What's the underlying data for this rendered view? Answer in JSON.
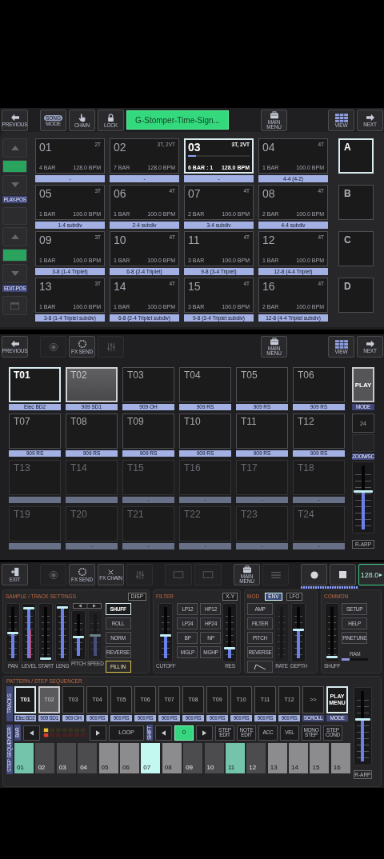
{
  "pattern_panel": {
    "toolbar": [
      [
        {
          "kind": "arrow-left",
          "label": "PREVIOUS",
          "disabled": false
        }
      ],
      [
        {
          "kind": "song",
          "badge": "SONG",
          "label": "MODE",
          "disabled": false
        },
        {
          "kind": "hand",
          "label": "CHAIN",
          "disabled": false
        },
        {
          "kind": "lock",
          "label": "LOCK",
          "disabled": false
        },
        {
          "kind": "title",
          "text": "G-Stomper-Time-Sign..."
        }
      ],
      [
        {
          "kind": "menu-box",
          "label": "MAIN MENU",
          "disabled": false
        }
      ],
      [
        {
          "kind": "grid",
          "label": "VIEW",
          "disabled": false
        },
        {
          "kind": "arrow-right",
          "label": "NEXT",
          "disabled": false
        }
      ]
    ],
    "play_pos_label": "PLAY-POS",
    "edit_pos_label": "EDIT-POS",
    "patterns": [
      {
        "number": "01",
        "tracks": "2T",
        "length": "4 BAR",
        "tempo": "128.0 BPM",
        "label": "-",
        "selected": false
      },
      {
        "number": "02",
        "tracks": "3T, 2VT",
        "length": "7 BAR",
        "tempo": "128.0 BPM",
        "label": "-",
        "selected": false
      },
      {
        "number": "03",
        "tracks": "3T, 2VT",
        "length": "6 BAR : 1",
        "tempo": "128.0 BPM",
        "label": "-",
        "selected": true,
        "progress": {
          "level": 0.13
        }
      },
      {
        "number": "04",
        "tracks": "4T",
        "length": "1 BAR",
        "tempo": "100.0 BPM",
        "label": "4-4 (4-2)",
        "selected": false
      },
      {
        "number": "05",
        "tracks": "3T",
        "length": "1 BAR",
        "tempo": "100.0 BPM",
        "label": "1-4 subdiv",
        "selected": false
      },
      {
        "number": "06",
        "tracks": "4T",
        "length": "1 BAR",
        "tempo": "100.0 BPM",
        "label": "2-4 subdiv",
        "selected": false
      },
      {
        "number": "07",
        "tracks": "4T",
        "length": "2 BAR",
        "tempo": "100.0 BPM",
        "label": "3-4 subdiv",
        "selected": false
      },
      {
        "number": "08",
        "tracks": "4T",
        "length": "2 BAR",
        "tempo": "100.0 BPM",
        "label": "4-4 subdiv",
        "selected": false
      },
      {
        "number": "09",
        "tracks": "3T",
        "length": "1 BAR",
        "tempo": "100.0 BPM",
        "label": "3-8 (1-4 Triplet)",
        "selected": false
      },
      {
        "number": "10",
        "tracks": "4T",
        "length": "1 BAR",
        "tempo": "100.0 BPM",
        "label": "6-8 (2-4 Triplet)",
        "selected": false
      },
      {
        "number": "11",
        "tracks": "4T",
        "length": "3 BAR",
        "tempo": "100.0 BPM",
        "label": "9-8 (3-4 Triplet)",
        "selected": false
      },
      {
        "number": "12",
        "tracks": "4T",
        "length": "1 BAR",
        "tempo": "100.0 BPM",
        "label": "12-8 (4-4 Triplet)",
        "selected": false
      },
      {
        "number": "13",
        "tracks": "3T",
        "length": "1 BAR",
        "tempo": "100.0 BPM",
        "label": "3-8 (1-4 Triplet subdiv)",
        "selected": false
      },
      {
        "number": "14",
        "tracks": "4T",
        "length": "1 BAR",
        "tempo": "100.0 BPM",
        "label": "6-8 (2-4 Triplet subdiv)",
        "selected": false
      },
      {
        "number": "15",
        "tracks": "4T",
        "length": "3 BAR",
        "tempo": "100.0 BPM",
        "label": "9-8 (3-4 Triplet subdiv)",
        "selected": false
      },
      {
        "number": "16",
        "tracks": "4T",
        "length": "2 BAR",
        "tempo": "100.0 BPM",
        "label": "12-8 (4-4 Triplet subdiv)",
        "selected": false
      }
    ],
    "banks": [
      {
        "name": "A",
        "selected": true
      },
      {
        "name": "B",
        "selected": false
      },
      {
        "name": "C",
        "selected": false
      },
      {
        "name": "D",
        "selected": false
      }
    ]
  },
  "track_panel": {
    "toolbar": [
      [
        {
          "kind": "arrow-left",
          "label": "PREVIOUS",
          "disabled": false
        }
      ],
      [
        {
          "kind": "dim-circle",
          "disabled": true
        },
        {
          "kind": "fx-send",
          "label": "FX SEND",
          "disabled": false
        },
        {
          "kind": "mixer",
          "disabled": true
        }
      ],
      [
        {
          "kind": "menu-box",
          "label": "MAIN MENU",
          "disabled": false
        }
      ],
      [
        {
          "kind": "grid",
          "label": "VIEW",
          "disabled": false
        },
        {
          "kind": "arrow-right",
          "label": "NEXT",
          "disabled": false
        }
      ]
    ],
    "tracks": [
      {
        "name": "T01",
        "sample": "Elec BD2",
        "selected": true,
        "highlighted": false,
        "disabled": false
      },
      {
        "name": "T02",
        "sample": "909 SD1",
        "selected": false,
        "highlighted": true,
        "disabled": false
      },
      {
        "name": "T03",
        "sample": "909 OH",
        "selected": false,
        "highlighted": false,
        "disabled": false
      },
      {
        "name": "T04",
        "sample": "909 RS",
        "selected": false,
        "highlighted": false,
        "disabled": false
      },
      {
        "name": "T05",
        "sample": "909 RS",
        "selected": false,
        "highlighted": false,
        "disabled": false
      },
      {
        "name": "T06",
        "sample": "909 RS",
        "selected": false,
        "highlighted": false,
        "disabled": false
      },
      {
        "name": "T07",
        "sample": "909 RS",
        "selected": false,
        "highlighted": false,
        "disabled": false
      },
      {
        "name": "T08",
        "sample": "909 RS",
        "selected": false,
        "highlighted": false,
        "disabled": false
      },
      {
        "name": "T09",
        "sample": "909 RS",
        "selected": false,
        "highlighted": false,
        "disabled": false
      },
      {
        "name": "T10",
        "sample": "909 RS",
        "selected": false,
        "highlighted": false,
        "disabled": false
      },
      {
        "name": "T11",
        "sample": "909 RS",
        "selected": false,
        "highlighted": false,
        "disabled": false
      },
      {
        "name": "T12",
        "sample": "909 RS",
        "selected": false,
        "highlighted": false,
        "disabled": false
      },
      {
        "name": "T13",
        "selected": false,
        "highlighted": false,
        "disabled": true
      },
      {
        "name": "T14",
        "selected": false,
        "highlighted": false,
        "disabled": true
      },
      {
        "name": "T15",
        "sample": "-",
        "selected": false,
        "highlighted": false,
        "disabled": true
      },
      {
        "name": "T16",
        "sample": "-",
        "selected": false,
        "highlighted": false,
        "disabled": true
      },
      {
        "name": "T17",
        "sample": "-",
        "selected": false,
        "highlighted": false,
        "disabled": true
      },
      {
        "name": "T18",
        "sample": "-",
        "selected": false,
        "highlighted": false,
        "disabled": true
      },
      {
        "name": "T19",
        "selected": false,
        "highlighted": false,
        "disabled": true
      },
      {
        "name": "T20",
        "sample": "-",
        "selected": false,
        "highlighted": false,
        "disabled": true
      },
      {
        "name": "T21",
        "sample": "-",
        "selected": false,
        "highlighted": false,
        "disabled": true
      },
      {
        "name": "T22",
        "sample": "-",
        "selected": false,
        "highlighted": false,
        "disabled": true
      },
      {
        "name": "T23",
        "sample": "-",
        "selected": false,
        "highlighted": false,
        "disabled": true
      },
      {
        "name": "T24",
        "sample": "-",
        "selected": false,
        "highlighted": false,
        "disabled": true
      }
    ],
    "play": "PLAY",
    "mode_label": "MODE",
    "resolution": "24",
    "zoom_label": "ZOOM/SC",
    "fader": {
      "level": 0.6
    },
    "arp": "R-ARP"
  },
  "control_panel": {
    "toolbar": [
      [
        {
          "kind": "exit",
          "label": "EXIT",
          "disabled": false
        }
      ],
      [
        {
          "kind": "dim-circle",
          "disabled": true
        },
        {
          "kind": "fx-send",
          "label": "FX SEND",
          "disabled": false
        },
        {
          "kind": "cross",
          "label": "FX CHAIN",
          "disabled": false
        },
        {
          "kind": "mixer",
          "disabled": true
        }
      ],
      [
        {
          "kind": "screen",
          "disabled": true
        },
        {
          "kind": "screen",
          "disabled": true
        }
      ],
      [
        {
          "kind": "menu-box",
          "label": "MAIN MENU",
          "disabled": false
        },
        {
          "kind": "list",
          "disabled": true
        }
      ],
      [
        {
          "kind": "record",
          "disabled": false
        },
        {
          "kind": "stop",
          "disabled": false
        },
        {
          "kind": "tempo",
          "text": "128.0"
        }
      ]
    ],
    "sample_settings": {
      "title": "SAMPLE / TRACK SETTINGS",
      "disp": "DISP",
      "faders": [
        {
          "label": "PAN",
          "level": 0.5
        },
        {
          "label": "LEVEL",
          "level": 0.97,
          "meter": {
            "level": 0.55
          }
        },
        {
          "label": "START",
          "level": 0
        },
        {
          "label": "LENG",
          "level": 1
        }
      ],
      "pitch_faders": [
        {
          "label": "PITCH",
          "level": 0.45
        },
        {
          "label": "SPEED",
          "level": 0.5,
          "disabled": true
        }
      ],
      "buttons": [
        {
          "text": "SHUFF",
          "selected": true,
          "highlighted": false
        },
        {
          "text": "ROLL",
          "selected": false,
          "highlighted": false
        },
        {
          "text": "NORM",
          "selected": false,
          "highlighted": false
        },
        {
          "text": "REVERSE",
          "selected": false,
          "highlighted": false
        },
        {
          "text": "FILL IN",
          "selected": false,
          "highlighted": true
        }
      ]
    },
    "filter": {
      "title": "FILTER",
      "xy": "X-Y",
      "cutoff": {
        "label": "CUTOFF",
        "level": 0.45
      },
      "types": [
        "LP12",
        "HP12",
        "LP24",
        "HP24",
        "BP",
        "NP",
        "MGLP",
        "MGHP"
      ],
      "resonance": {
        "label": "RES",
        "level": 0.2
      }
    },
    "mod": {
      "title": "MOD",
      "sources": [
        {
          "text": "ENV",
          "selected": true
        },
        {
          "text": "LFO",
          "selected": false
        }
      ],
      "targets": [
        "AMP",
        "FILTER",
        "PITCH",
        "REVERSE"
      ],
      "rate": {
        "label": "RATE",
        "disabled": true
      },
      "depth": {
        "label": "DEPTH",
        "level": 0.55
      }
    },
    "common": {
      "title": "COMMON",
      "shuffle": {
        "label": "SHUFF",
        "level": 0.03
      },
      "buttons": [
        "SETUP",
        "HELP",
        "FINETUNE"
      ],
      "ram": {
        "label": "RAM",
        "level": 0.3
      }
    },
    "sequencer": {
      "title": "PATTERN / STEP SEQUENCER",
      "tracks_label": "TRACKS",
      "tracks": [
        {
          "name": "T01",
          "sample": "Elec BD2",
          "selected": true,
          "highlighted": false
        },
        {
          "name": "T02",
          "sample": "909 SD1",
          "selected": false,
          "highlighted": true
        },
        {
          "name": "T03",
          "sample": "909 OH",
          "selected": false,
          "highlighted": false
        },
        {
          "name": "T04",
          "sample": "909 RS",
          "selected": false,
          "highlighted": false
        },
        {
          "name": "T05",
          "sample": "909 RS",
          "selected": false,
          "highlighted": false
        },
        {
          "name": "T06",
          "sample": "909 RS",
          "selected": false,
          "highlighted": false
        },
        {
          "name": "T07",
          "sample": "909 RS",
          "selected": false,
          "highlighted": false
        },
        {
          "name": "T08",
          "sample": "909 RS",
          "selected": false,
          "highlighted": false
        },
        {
          "name": "T09",
          "sample": "909 RS",
          "selected": false,
          "highlighted": false
        },
        {
          "name": "T10",
          "sample": "909 RS",
          "selected": false,
          "highlighted": false
        },
        {
          "name": "T11",
          "sample": "909 RS",
          "selected": false,
          "highlighted": false
        },
        {
          "name": "T12",
          "sample": "909 RS",
          "selected": false,
          "highlighted": false
        }
      ],
      "scroll": {
        "text": ">>",
        "label": "SCROLL"
      },
      "play_menu": {
        "text": "PLAY MENU",
        "label": "MODE"
      },
      "fader": {
        "level": 0.6
      },
      "arp": "R-ARP",
      "bar_label": "BAR",
      "loop": "LOOP",
      "shift_label": "SHIFT",
      "shift_value": "0",
      "edit_buttons": [
        "STEP EDIT",
        "NOTE EDIT",
        "ACC",
        "VEL",
        "MONO STEP",
        "STEP COND"
      ],
      "steps_label": "STEP SEQUENCER",
      "steps": [
        {
          "number": "01",
          "on": true,
          "current": false
        },
        {
          "number": "02",
          "on": false,
          "current": false
        },
        {
          "number": "03",
          "on": false,
          "current": false
        },
        {
          "number": "04",
          "on": false,
          "current": false
        },
        {
          "number": "05",
          "on": false,
          "current": false
        },
        {
          "number": "06",
          "on": false,
          "current": false
        },
        {
          "number": "07",
          "on": false,
          "current": true
        },
        {
          "number": "08",
          "on": false,
          "current": false
        },
        {
          "number": "09",
          "on": false,
          "current": false
        },
        {
          "number": "10",
          "on": false,
          "current": false
        },
        {
          "number": "11",
          "on": true,
          "current": false
        },
        {
          "number": "12",
          "on": false,
          "current": false
        },
        {
          "number": "13",
          "on": false,
          "current": false
        },
        {
          "number": "14",
          "on": false,
          "current": false
        },
        {
          "number": "15",
          "on": false,
          "current": false
        },
        {
          "number": "16",
          "on": false,
          "current": false
        }
      ]
    }
  }
}
